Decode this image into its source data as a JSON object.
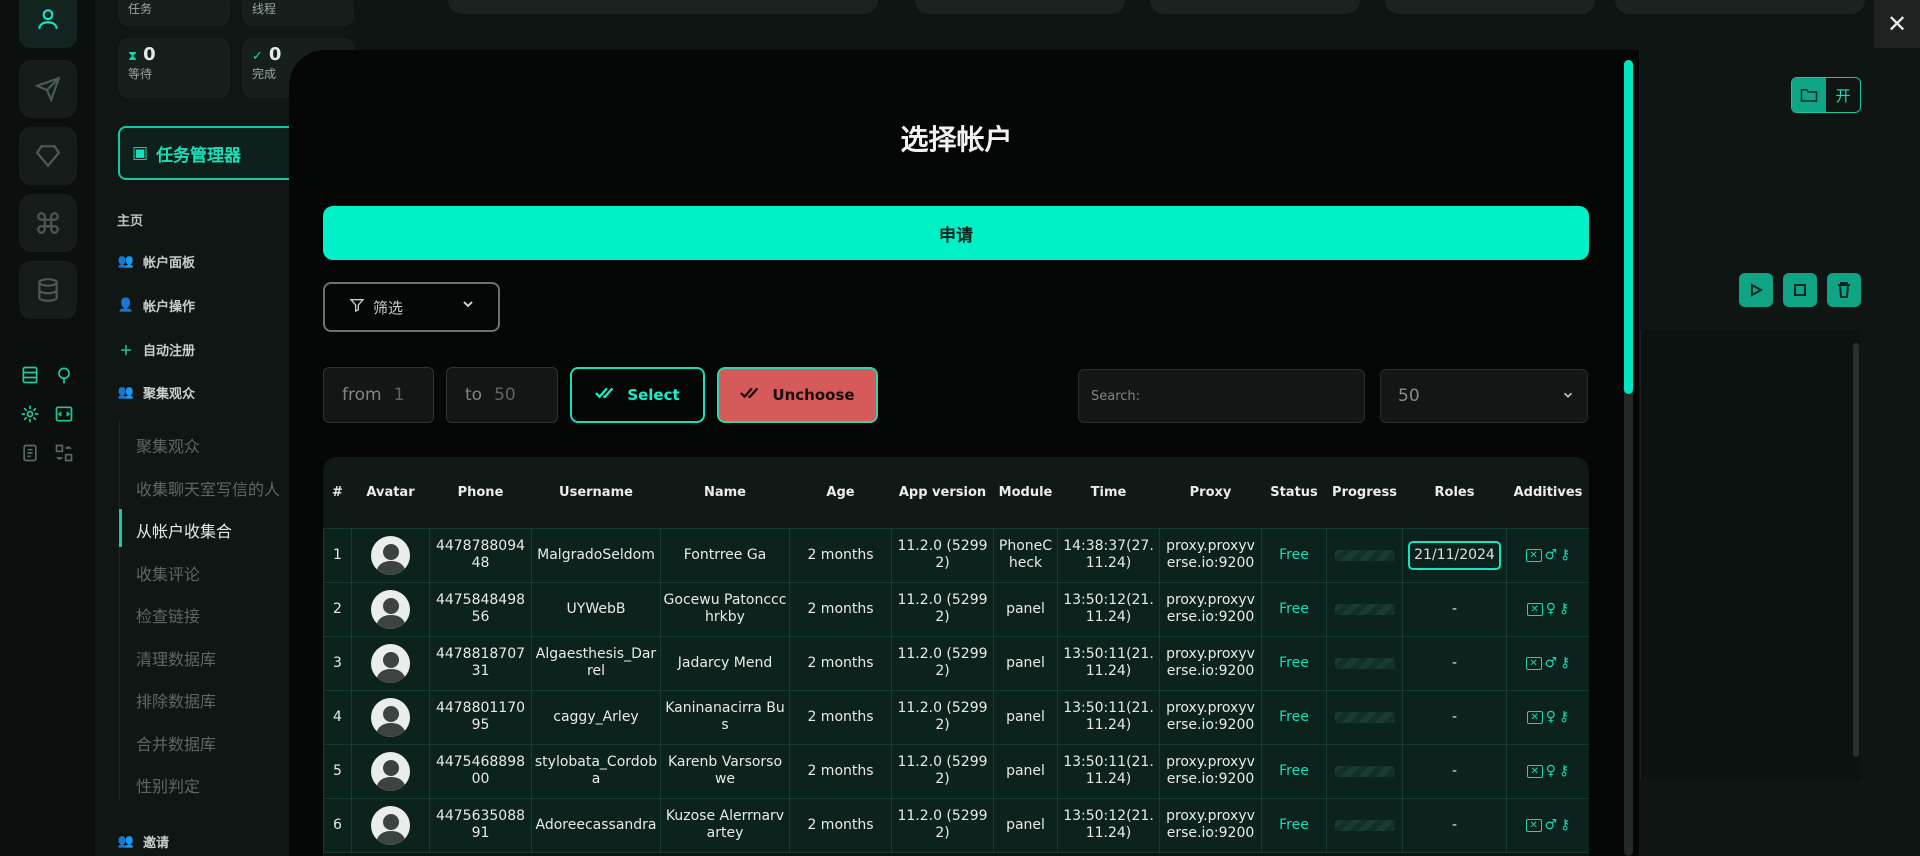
{
  "sidebar": {
    "stats": [
      {
        "label": "任务",
        "value": ""
      },
      {
        "label": "线程",
        "value": ""
      },
      {
        "label": "等待",
        "value": "0",
        "icon": "hourglass-icon"
      },
      {
        "label": "完成",
        "value": "0",
        "icon": "check-circle-icon"
      }
    ],
    "task_manager": "任务管理器",
    "home": "主页",
    "items": [
      {
        "label": "帐户面板",
        "icon": "users-icon"
      },
      {
        "label": "帐户操作",
        "icon": "user-icon"
      },
      {
        "label": "自动注册",
        "icon": "user-plus-icon"
      },
      {
        "label": "聚集观众",
        "icon": "users-group-icon"
      }
    ],
    "sub_items": [
      "聚集观众",
      "收集聊天室写信的人",
      "从帐户收集合",
      "收集评论",
      "检查链接",
      "清理数据库",
      "排除数据库",
      "合并数据库",
      "性别判定"
    ],
    "active_sub": 2,
    "invite": "邀请"
  },
  "toolbar": {
    "open_label": "开"
  },
  "modal": {
    "title": "选择帐户",
    "apply": "申请",
    "filter": "筛选",
    "from_label": "from",
    "from_value": "1",
    "to_label": "to",
    "to_value": "50",
    "select": "Select",
    "unchoose": "Unchoose",
    "search_placeholder": "Search:",
    "page_size": "50"
  },
  "table": {
    "headers": [
      "#",
      "Avatar",
      "Phone",
      "Username",
      "Name",
      "Age",
      "App version",
      "Module",
      "Time",
      "Proxy",
      "Status",
      "Progress",
      "Roles",
      "Additives"
    ],
    "rows": [
      {
        "n": "1",
        "phone": "447878809448",
        "username": "MalgradoSeldom",
        "name": "Fontrree Ga",
        "age": "2 months",
        "app": "11.2.0 (52992)",
        "module": "PhoneCheck",
        "time": "14:38:37(27.11.24)",
        "proxy": "proxy.proxyverse.io:9200",
        "status": "Free",
        "role": "21/11/2024",
        "gender": "♂"
      },
      {
        "n": "2",
        "phone": "447584849856",
        "username": "UYWebB",
        "name": "Gocewu Patonccchrkby",
        "age": "2 months",
        "app": "11.2.0 (52992)",
        "module": "panel",
        "time": "13:50:12(21.11.24)",
        "proxy": "proxy.proxyverse.io:9200",
        "status": "Free",
        "role": "-",
        "gender": "♀"
      },
      {
        "n": "3",
        "phone": "447881870731",
        "username": "Algaesthesis_Darrel",
        "name": "Jadarcy Mend",
        "age": "2 months",
        "app": "11.2.0 (52992)",
        "module": "panel",
        "time": "13:50:11(21.11.24)",
        "proxy": "proxy.proxyverse.io:9200",
        "status": "Free",
        "role": "-",
        "gender": "♂"
      },
      {
        "n": "4",
        "phone": "447880117095",
        "username": "caggy_Arley",
        "name": "Kaninanacirra Bus",
        "age": "2 months",
        "app": "11.2.0 (52992)",
        "module": "panel",
        "time": "13:50:11(21.11.24)",
        "proxy": "proxy.proxyverse.io:9200",
        "status": "Free",
        "role": "-",
        "gender": "♀"
      },
      {
        "n": "5",
        "phone": "447546889800",
        "username": "stylobata_Cordoba",
        "name": "Karenb Varsorsowe",
        "age": "2 months",
        "app": "11.2.0 (52992)",
        "module": "panel",
        "time": "13:50:11(21.11.24)",
        "proxy": "proxy.proxyverse.io:9200",
        "status": "Free",
        "role": "-",
        "gender": "♀"
      },
      {
        "n": "6",
        "phone": "447563508891",
        "username": "Adoreecassandra",
        "name": "Kuzose Alerrnarvartey",
        "age": "2 months",
        "app": "11.2.0 (52992)",
        "module": "panel",
        "time": "13:50:12(21.11.24)",
        "proxy": "proxy.proxyverse.io:9200",
        "status": "Free",
        "role": "-",
        "gender": "♂"
      }
    ]
  },
  "colors": {
    "accent": "#00f0c8",
    "danger": "#d65a5a",
    "background": "#050606"
  }
}
